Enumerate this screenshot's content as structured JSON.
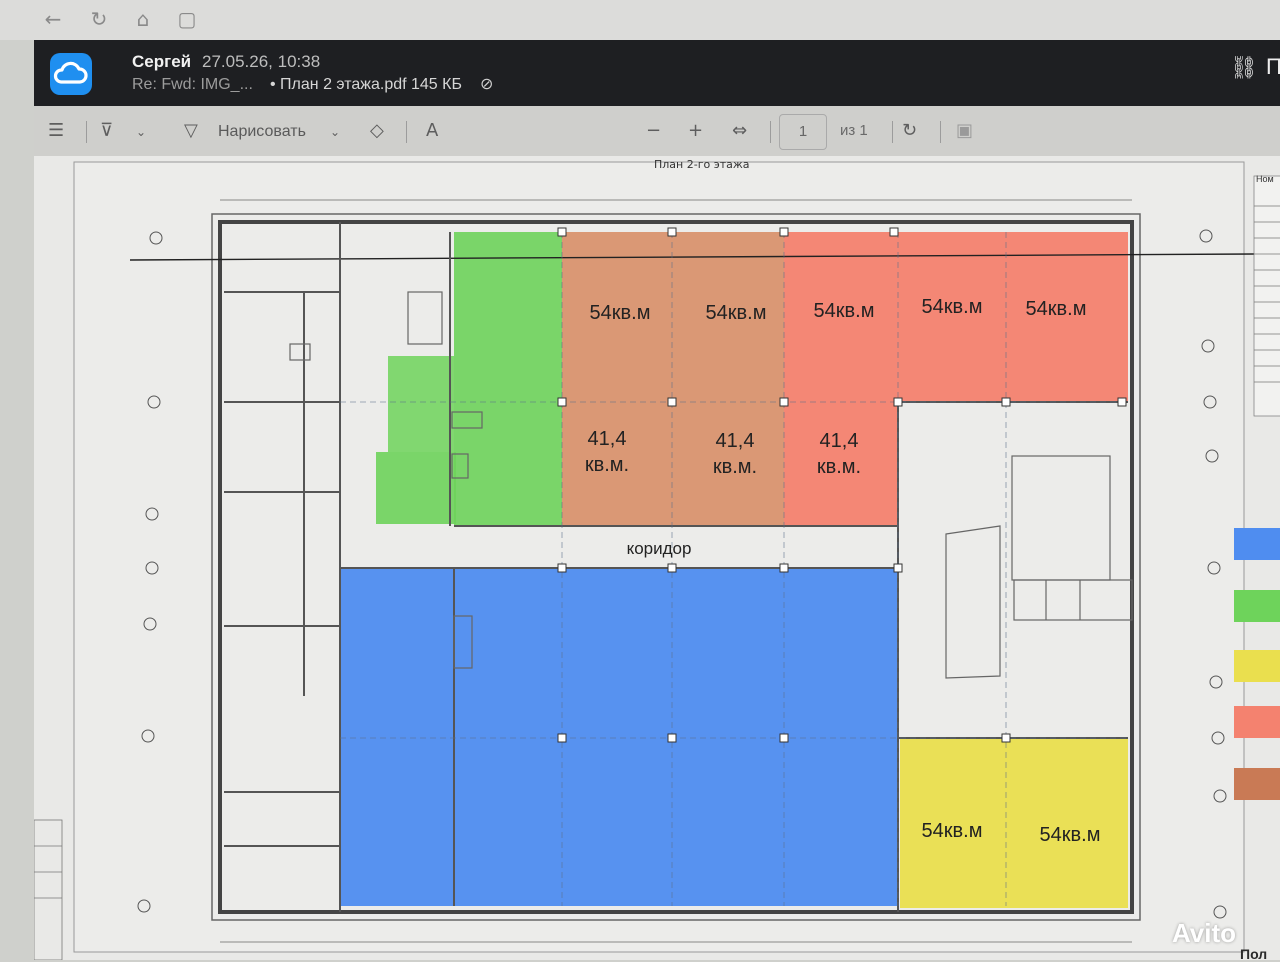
{
  "header": {
    "sender": "Сергей",
    "datetime": "27.05.26, 10:38",
    "subject": "Re: Fwd: IMG_...",
    "file": "• План 2 этажа.pdf 145 КБ",
    "cut_label": "П"
  },
  "toolbar": {
    "draw_label": "Нарисовать",
    "page_current": "1",
    "page_of": "из 1",
    "text_tool": "A"
  },
  "plan": {
    "title": "План 2-го этажа",
    "corridor": "коридор",
    "rooms_top": [
      "54кв.м",
      "54кв.м",
      "54кв.м",
      "54кв.м",
      "54кв.м"
    ],
    "rooms_mid": [
      "41,4\nкв.м.",
      "41,4\nкв.м.",
      "41,4\nкв.м."
    ],
    "rooms_bottom_right": [
      "54кв.м",
      "54кв.м"
    ],
    "colors": {
      "green": "#6ed35b",
      "brown": "#d9936f",
      "red": "#f4826f",
      "blue": "#4f8df0",
      "yellow": "#eadf4e",
      "legend_brown": "#c97a55"
    }
  },
  "legend": [
    "#4f8df0",
    "#6ed35b",
    "#eadf4e",
    "#f4826f",
    "#c97a55"
  ],
  "watermark": "Avito",
  "bottom_cut": "Пол",
  "right_cut": "Ном"
}
